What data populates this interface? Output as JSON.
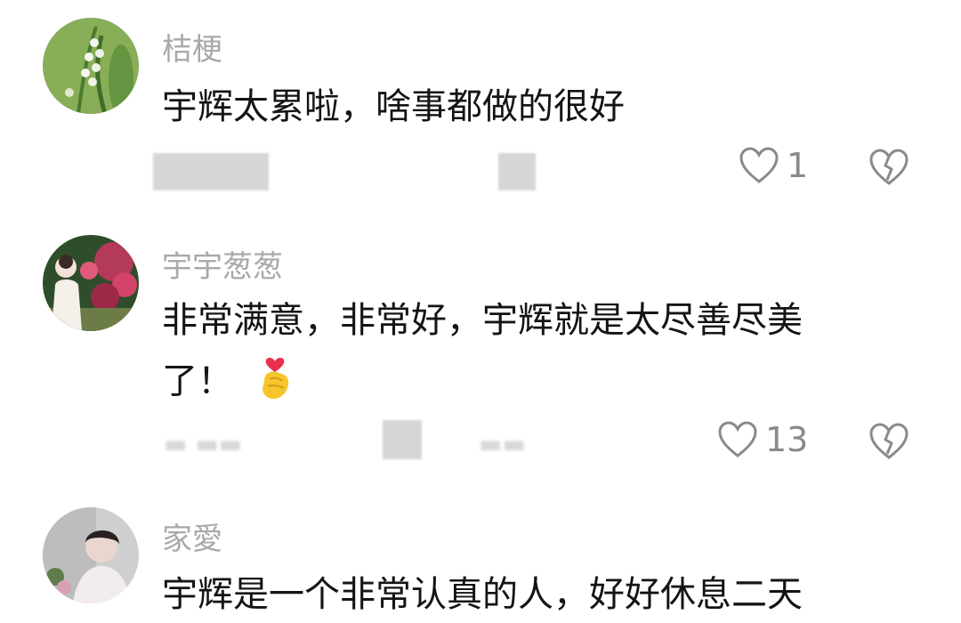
{
  "comments": [
    {
      "username": "桔梗",
      "text": "宇辉太累啦，啥事都做的很好",
      "likes": "1"
    },
    {
      "username": "宇宇葱葱",
      "text_line1": "非常满意，非常好，宇辉就是太尽善尽美",
      "text_line2": "了！",
      "emoji": "finger-heart-emoji",
      "likes": "13"
    },
    {
      "username": "家愛",
      "text": "宇辉是一个非常认真的人，好好休息二天"
    }
  ],
  "icons": {
    "like": "heart-outline-icon",
    "dislike": "broken-heart-icon"
  },
  "colors": {
    "username": "#a9a9a9",
    "text": "#141414",
    "icon": "#8a8a8a",
    "emoji_heart": "#e8304a",
    "emoji_hand": "#f6c52c"
  }
}
